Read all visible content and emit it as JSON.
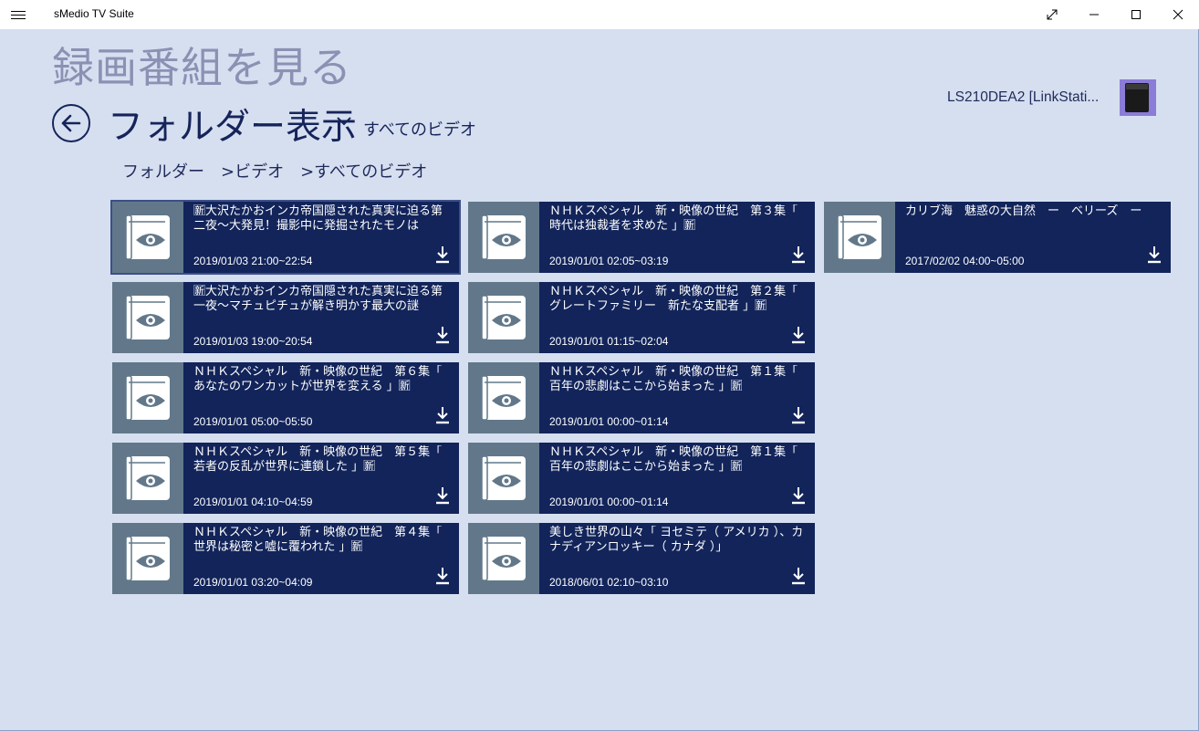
{
  "app": {
    "title": "sMedio TV Suite",
    "window_controls": [
      "restore-fullscreen",
      "minimize",
      "maximize",
      "close"
    ]
  },
  "page": {
    "title": "録画番組を見る",
    "folder_title": "フォルダー表示",
    "folder_filter": "すべてのビデオ",
    "device_name": "LS210DEA2 [LinkStati...",
    "breadcrumb": [
      "フォルダー",
      ">ビデオ",
      ">すべてのビデオ"
    ]
  },
  "colors": {
    "background": "#d6dff0",
    "tile": "#12245a",
    "thumb": "#62788a",
    "title_muted": "#8a91b3",
    "accent_dark": "#16245a"
  },
  "recordings": [
    {
      "title": "🈟大沢たかおインカ帝国隠された真実に迫る第二夜～大発見！撮影中に発掘されたモノは",
      "time": "2019/01/03 21:00~22:54",
      "selected": true
    },
    {
      "title": "ＮＨＫスペシャル　新・映像の世紀　第３集「 時代は独裁者を求めた 」🈟",
      "time": "2019/01/01 02:05~03:19"
    },
    {
      "title": "カリブ海　魅惑の大自然　ー　ベリーズ　ー",
      "time": "2017/02/02 04:00~05:00"
    },
    {
      "title": "🈟大沢たかおインカ帝国隠された真実に迫る第一夜～マチュピチュが解き明かす最大の謎",
      "time": "2019/01/03 19:00~20:54"
    },
    {
      "title": "ＮＨＫスペシャル　新・映像の世紀　第２集「 グレートファミリー　新たな支配者 」🈟",
      "time": "2019/01/01 01:15~02:04"
    },
    {
      "title": "ＮＨＫスペシャル　新・映像の世紀　第６集「 あなたのワンカットが世界を変える 」🈟",
      "time": "2019/01/01 05:00~05:50"
    },
    {
      "title": "ＮＨＫスペシャル　新・映像の世紀　第１集「 百年の悲劇はここから始まった 」🈟",
      "time": "2019/01/01 00:00~01:14"
    },
    {
      "title": "ＮＨＫスペシャル　新・映像の世紀　第５集「 若者の反乱が世界に連鎖した 」🈟",
      "time": "2019/01/01 04:10~04:59"
    },
    {
      "title": "ＮＨＫスペシャル　新・映像の世紀　第１集「 百年の悲劇はここから始まった 」🈟",
      "time": "2019/01/01 00:00~01:14"
    },
    {
      "title": "ＮＨＫスペシャル　新・映像の世紀　第４集「 世界は秘密と嘘に覆われた 」🈟",
      "time": "2019/01/01 03:20~04:09"
    },
    {
      "title": "美しき世界の山々「 ヨセミテ（ アメリカ ）、カナディアンロッキー（ カナダ ）」",
      "time": "2018/06/01 02:10~03:10"
    }
  ]
}
